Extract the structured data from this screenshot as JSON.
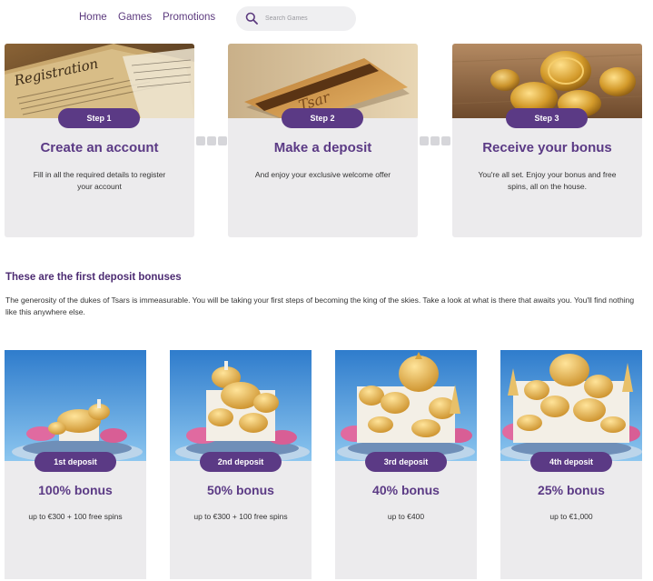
{
  "nav": {
    "items": [
      "Home",
      "Games",
      "Promotions"
    ],
    "search_placeholder": "Search Games"
  },
  "steps": [
    {
      "badge": "Step 1",
      "title": "Create an account",
      "description": "Fill in all the required details to register your account",
      "image": "registration-document"
    },
    {
      "badge": "Step 2",
      "title": "Make a deposit",
      "description": "And enjoy your exclusive welcome offer",
      "image": "bank-card"
    },
    {
      "badge": "Step 3",
      "title": "Receive your bonus",
      "description": "You're all set. Enjoy your bonus and free spins, all on the house.",
      "image": "gold-coins"
    }
  ],
  "bonuses_section": {
    "heading": "These are the first deposit bonuses",
    "intro": "The generosity of the dukes of Tsars is immeasurable. You will be taking your first steps of becoming the king of the skies. Take a look at what is there that awaits you. You'll find nothing like this anywhere else."
  },
  "bonuses": [
    {
      "badge": "1st deposit",
      "title": "100% bonus",
      "description": "up to €300 + 100 free spins",
      "image": "floating-palace-small"
    },
    {
      "badge": "2nd deposit",
      "title": "50% bonus",
      "description": "up to €300 + 100 free spins",
      "image": "floating-palace-medium"
    },
    {
      "badge": "3rd deposit",
      "title": "40% bonus",
      "description": "up to €400",
      "image": "floating-palace-large"
    },
    {
      "badge": "4th deposit",
      "title": "25% bonus",
      "description": "up to €1,000",
      "image": "floating-palace-largest"
    }
  ],
  "colors": {
    "brand_purple": "#5b3a85",
    "nav_text": "#5c3a7e",
    "card_background": "#ecebed",
    "sky_blue": "#3f8fd6",
    "gold": "#d9a33a"
  }
}
